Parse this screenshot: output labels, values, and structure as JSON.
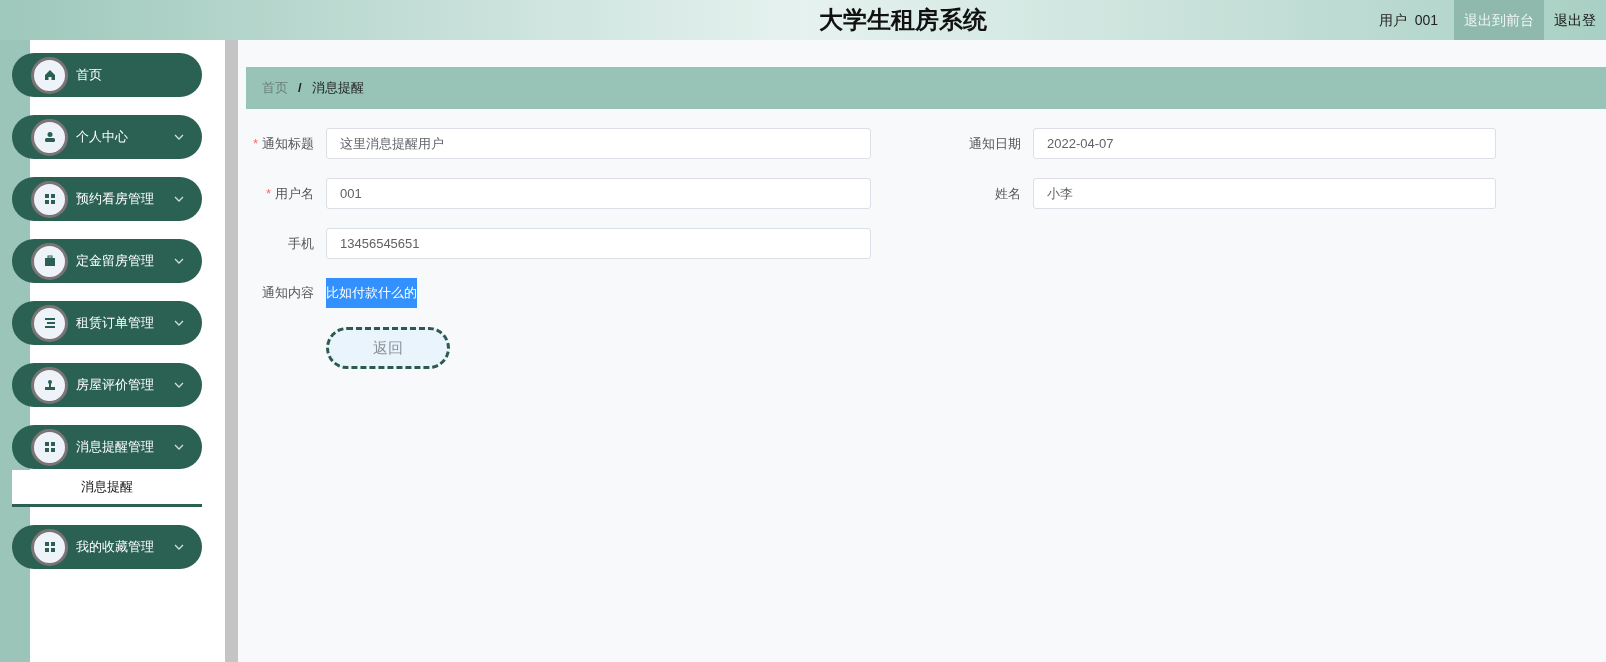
{
  "header": {
    "title": "大学生租房系统",
    "user_label": "用户",
    "user_value": "001",
    "links": [
      {
        "label": "退出到前台",
        "hovered": true
      },
      {
        "label": "退出登",
        "hovered": false
      }
    ]
  },
  "sidebar": {
    "items": [
      {
        "label": "首页",
        "has_arrow": false
      },
      {
        "label": "个人中心",
        "has_arrow": true
      },
      {
        "label": "预约看房管理",
        "has_arrow": true
      },
      {
        "label": "定金留房管理",
        "has_arrow": true
      },
      {
        "label": "租赁订单管理",
        "has_arrow": true
      },
      {
        "label": "房屋评价管理",
        "has_arrow": true
      },
      {
        "label": "消息提醒管理",
        "has_arrow": true,
        "children": [
          {
            "label": "消息提醒"
          }
        ]
      },
      {
        "label": "我的收藏管理",
        "has_arrow": true
      }
    ]
  },
  "breadcrumb": [
    {
      "label": "首页",
      "current": false
    },
    {
      "label": "消息提醒",
      "current": true
    }
  ],
  "breadcrumb_separator": "/",
  "form": {
    "rows": [
      [
        {
          "label": "通知标题",
          "required": true,
          "kind": "input",
          "value": "这里消息提醒用户"
        },
        {
          "label": "通知日期",
          "required": false,
          "kind": "input",
          "value": "2022-04-07"
        }
      ],
      [
        {
          "label": "用户名",
          "required": true,
          "kind": "input",
          "value": "001"
        },
        {
          "label": "姓名",
          "required": false,
          "kind": "input",
          "value": "小李"
        }
      ],
      [
        {
          "label": "手机",
          "required": false,
          "kind": "input",
          "value": "13456545651"
        }
      ],
      [
        {
          "label": "通知内容",
          "required": false,
          "kind": "selected_text",
          "value": "比如付款什么的"
        }
      ]
    ],
    "required_mark": "*",
    "back_button": "返回"
  }
}
